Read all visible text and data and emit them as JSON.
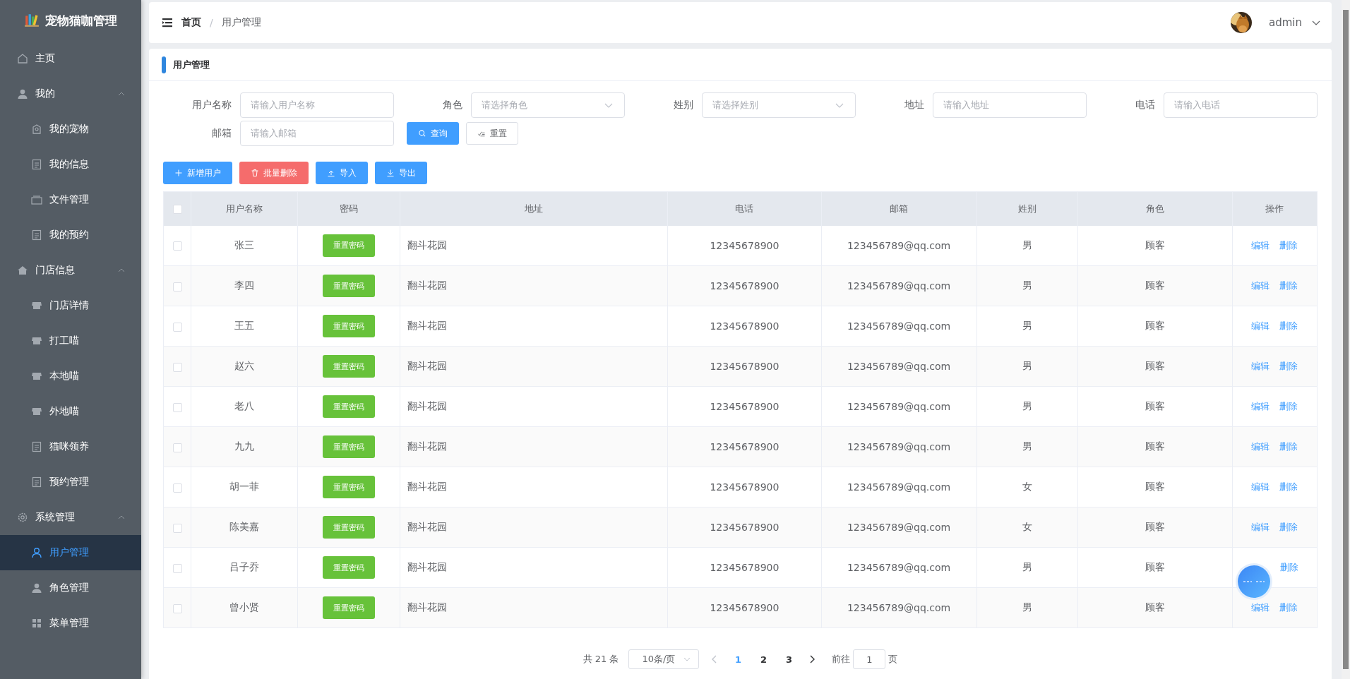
{
  "sidebar": {
    "title": "宠物猫咖管理",
    "items": [
      {
        "label": "主页",
        "kind": "home",
        "selected": false
      },
      {
        "label": "我的",
        "kind": "user",
        "expanded": true,
        "children": [
          {
            "label": "我的宠物",
            "kind": "pet",
            "selected": false
          },
          {
            "label": "我的信息",
            "kind": "doc",
            "selected": false
          },
          {
            "label": "文件管理",
            "kind": "folder",
            "selected": false
          },
          {
            "label": "我的预约",
            "kind": "doc",
            "selected": false
          }
        ]
      },
      {
        "label": "门店信息",
        "kind": "home2",
        "expanded": true,
        "children": [
          {
            "label": "门店详情",
            "kind": "store",
            "selected": false
          },
          {
            "label": "打工喵",
            "kind": "store",
            "selected": false
          },
          {
            "label": "本地喵",
            "kind": "store",
            "selected": false
          },
          {
            "label": "外地喵",
            "kind": "store",
            "selected": false
          },
          {
            "label": "猫咪领养",
            "kind": "doc",
            "selected": false
          },
          {
            "label": "预约管理",
            "kind": "doc",
            "selected": false
          }
        ]
      },
      {
        "label": "系统管理",
        "kind": "gear",
        "expanded": true,
        "children": [
          {
            "label": "用户管理",
            "kind": "user2",
            "selected": true
          },
          {
            "label": "角色管理",
            "kind": "user",
            "selected": false
          },
          {
            "label": "菜单管理",
            "kind": "grid",
            "selected": false
          }
        ]
      }
    ]
  },
  "header": {
    "breadcrumb": [
      "首页",
      "用户管理"
    ],
    "breadcrumb_separator": "/",
    "user": "admin"
  },
  "panel_title": "用户管理",
  "filters": [
    {
      "label": "用户名称",
      "kind": "input",
      "placeholder": "请输入用户名称"
    },
    {
      "label": "角色",
      "kind": "select",
      "placeholder": "请选择角色"
    },
    {
      "label": "姓别",
      "kind": "select",
      "placeholder": "请选择姓别"
    },
    {
      "label": "地址",
      "kind": "input",
      "placeholder": "请输入地址"
    },
    {
      "label": "电话",
      "kind": "input",
      "placeholder": "请输入电话"
    },
    {
      "label": "邮箱",
      "kind": "input",
      "placeholder": "请输入邮箱"
    }
  ],
  "search_buttons": [
    {
      "label": "查询",
      "kind": "primary"
    },
    {
      "label": "重置",
      "kind": "plain"
    }
  ],
  "toolbar": [
    {
      "label": "新增用户",
      "kind": "add"
    },
    {
      "label": "批量删除",
      "kind": "delete"
    },
    {
      "label": "导入",
      "kind": "import"
    },
    {
      "label": "导出",
      "kind": "export"
    }
  ],
  "table": {
    "header_checked": false,
    "columns": [
      "用户名称",
      "密码",
      "地址",
      "电话",
      "邮箱",
      "姓别",
      "角色",
      "操作"
    ],
    "rows": [
      {
        "checked": false,
        "name": "张三",
        "reset": "重置密码",
        "address": "翻斗花园",
        "phone": "12345678900",
        "email": "123456789@qq.com",
        "gender": "男",
        "role": "顾客",
        "edit": "编辑",
        "delete": "删除"
      },
      {
        "checked": false,
        "name": "李四",
        "reset": "重置密码",
        "address": "翻斗花园",
        "phone": "12345678900",
        "email": "123456789@qq.com",
        "gender": "男",
        "role": "顾客",
        "edit": "编辑",
        "delete": "删除"
      },
      {
        "checked": false,
        "name": "王五",
        "reset": "重置密码",
        "address": "翻斗花园",
        "phone": "12345678900",
        "email": "123456789@qq.com",
        "gender": "男",
        "role": "顾客",
        "edit": "编辑",
        "delete": "删除"
      },
      {
        "checked": false,
        "name": "赵六",
        "reset": "重置密码",
        "address": "翻斗花园",
        "phone": "12345678900",
        "email": "123456789@qq.com",
        "gender": "男",
        "role": "顾客",
        "edit": "编辑",
        "delete": "删除"
      },
      {
        "checked": false,
        "name": "老八",
        "reset": "重置密码",
        "address": "翻斗花园",
        "phone": "12345678900",
        "email": "123456789@qq.com",
        "gender": "男",
        "role": "顾客",
        "edit": "编辑",
        "delete": "删除"
      },
      {
        "checked": false,
        "name": "九九",
        "reset": "重置密码",
        "address": "翻斗花园",
        "phone": "12345678900",
        "email": "123456789@qq.com",
        "gender": "男",
        "role": "顾客",
        "edit": "编辑",
        "delete": "删除"
      },
      {
        "checked": false,
        "name": "胡一菲",
        "reset": "重置密码",
        "address": "翻斗花园",
        "phone": "12345678900",
        "email": "123456789@qq.com",
        "gender": "女",
        "role": "顾客",
        "edit": "编辑",
        "delete": "删除"
      },
      {
        "checked": false,
        "name": "陈美嘉",
        "reset": "重置密码",
        "address": "翻斗花园",
        "phone": "12345678900",
        "email": "123456789@qq.com",
        "gender": "女",
        "role": "顾客",
        "edit": "编辑",
        "delete": "删除"
      },
      {
        "checked": false,
        "name": "吕子乔",
        "reset": "重置密码",
        "address": "翻斗花园",
        "phone": "12345678900",
        "email": "123456789@qq.com",
        "gender": "男",
        "role": "顾客",
        "delete": "删除"
      },
      {
        "checked": false,
        "name": "曾小贤",
        "reset": "重置密码",
        "address": "翻斗花园",
        "phone": "12345678900",
        "email": "123456789@qq.com",
        "gender": "男",
        "role": "顾客",
        "edit": "编辑",
        "delete": "删除"
      }
    ]
  },
  "pagination": {
    "total": "共 21 条",
    "page_size": "10条/页",
    "pages": [
      {
        "label": "1",
        "selected": true
      },
      {
        "label": "2",
        "selected": false
      },
      {
        "label": "3",
        "selected": false
      }
    ],
    "goto_label": "前往",
    "goto_value": "1",
    "goto_suffix": "页"
  }
}
